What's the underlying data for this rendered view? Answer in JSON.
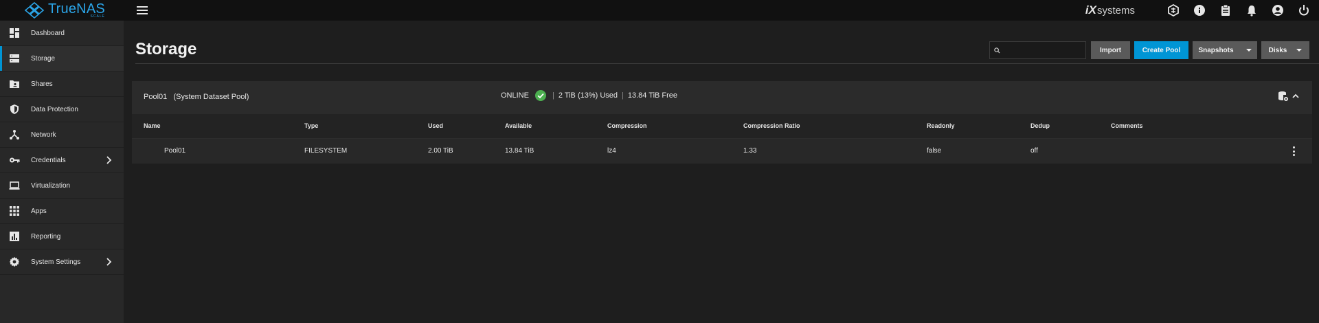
{
  "app": {
    "name": "TrueNAS",
    "edition": "SCALE",
    "vendor": "systems",
    "vendor_prefix": "iX"
  },
  "topbar": {
    "icons": [
      "truecommand-icon",
      "info-icon",
      "clipboard-icon",
      "bell-icon",
      "account-icon",
      "power-icon"
    ]
  },
  "sidebar": {
    "items": [
      {
        "label": "Dashboard",
        "icon": "dashboard-icon",
        "active": false,
        "has_children": false
      },
      {
        "label": "Storage",
        "icon": "storage-icon",
        "active": true,
        "has_children": false
      },
      {
        "label": "Shares",
        "icon": "shares-icon",
        "active": false,
        "has_children": false
      },
      {
        "label": "Data Protection",
        "icon": "shield-icon",
        "active": false,
        "has_children": false
      },
      {
        "label": "Network",
        "icon": "network-icon",
        "active": false,
        "has_children": false
      },
      {
        "label": "Credentials",
        "icon": "key-icon",
        "active": false,
        "has_children": true
      },
      {
        "label": "Virtualization",
        "icon": "laptop-icon",
        "active": false,
        "has_children": false
      },
      {
        "label": "Apps",
        "icon": "apps-icon",
        "active": false,
        "has_children": false
      },
      {
        "label": "Reporting",
        "icon": "reporting-icon",
        "active": false,
        "has_children": false
      },
      {
        "label": "System Settings",
        "icon": "gear-icon",
        "active": false,
        "has_children": true
      }
    ]
  },
  "page": {
    "title": "Storage",
    "search_placeholder": "",
    "buttons": {
      "import": "Import",
      "create_pool": "Create Pool",
      "snapshots": "Snapshots",
      "disks": "Disks"
    }
  },
  "pool": {
    "name": "Pool01",
    "tag": "(System Dataset Pool)",
    "status": "ONLINE",
    "used": "2 TiB (13%) Used",
    "free": "13.84 TiB Free",
    "separator": "|",
    "columns": [
      "Name",
      "Type",
      "Used",
      "Available",
      "Compression",
      "Compression Ratio",
      "Readonly",
      "Dedup",
      "Comments"
    ],
    "rows": [
      {
        "name": "Pool01",
        "type": "FILESYSTEM",
        "used": "2.00 TiB",
        "available": "13.84 TiB",
        "compression": "lz4",
        "compression_ratio": "1.33",
        "readonly": "false",
        "dedup": "off",
        "comments": ""
      }
    ]
  },
  "colors": {
    "accent": "#0095d5",
    "brand": "#2ba5e8",
    "online": "#4caf50",
    "button_gray": "#5a5a5a"
  }
}
